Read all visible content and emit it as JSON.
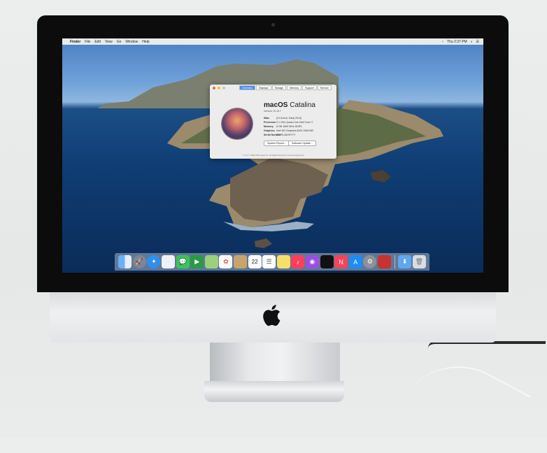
{
  "menubar": {
    "items": [
      "Finder",
      "File",
      "Edit",
      "View",
      "Go",
      "Window",
      "Help"
    ],
    "clock": "Thu 2:37 PM"
  },
  "about_window": {
    "tabs": [
      "Overview",
      "Displays",
      "Storage",
      "Memory",
      "Support",
      "Service"
    ],
    "os_name_bold": "macOS",
    "os_name_light": "Catalina",
    "version": "Version 10.15.7",
    "specs": [
      {
        "key": "iMac",
        "value": "(21.5-inch, Early 2013)"
      },
      {
        "key": "Processor",
        "value": "3.1 GHz Quad-Core Intel Core i7"
      },
      {
        "key": "Memory",
        "value": "8 GB 1600 MHz DDR3"
      },
      {
        "key": "Graphics",
        "value": "Intel HD Graphics 8200 1536 MB"
      },
      {
        "key": "Serial Number",
        "value": "C02KL4AXHYYY"
      }
    ],
    "buttons": [
      "System Report...",
      "Software Update..."
    ],
    "footer": "™ and © 1983-2020 Apple Inc. All Rights Reserved. License Agreement"
  },
  "dock": {
    "icons": [
      "finder-icon",
      "launchpad-icon",
      "safari-icon",
      "preview-icon",
      "messages-icon",
      "facetime-icon",
      "maps-icon",
      "photos-icon",
      "contacts-icon",
      "calendar-icon",
      "reminders-icon",
      "notes-icon",
      "music-icon",
      "podcasts-icon",
      "tv-icon",
      "news-icon",
      "app-store-icon",
      "system-preferences-icon",
      "photo-booth-icon",
      "downloads-icon",
      "trash-icon"
    ],
    "calendar_day": "22"
  },
  "colors": {
    "dock_bg": "#c8d2e1",
    "accent": "#4a8ff5"
  }
}
